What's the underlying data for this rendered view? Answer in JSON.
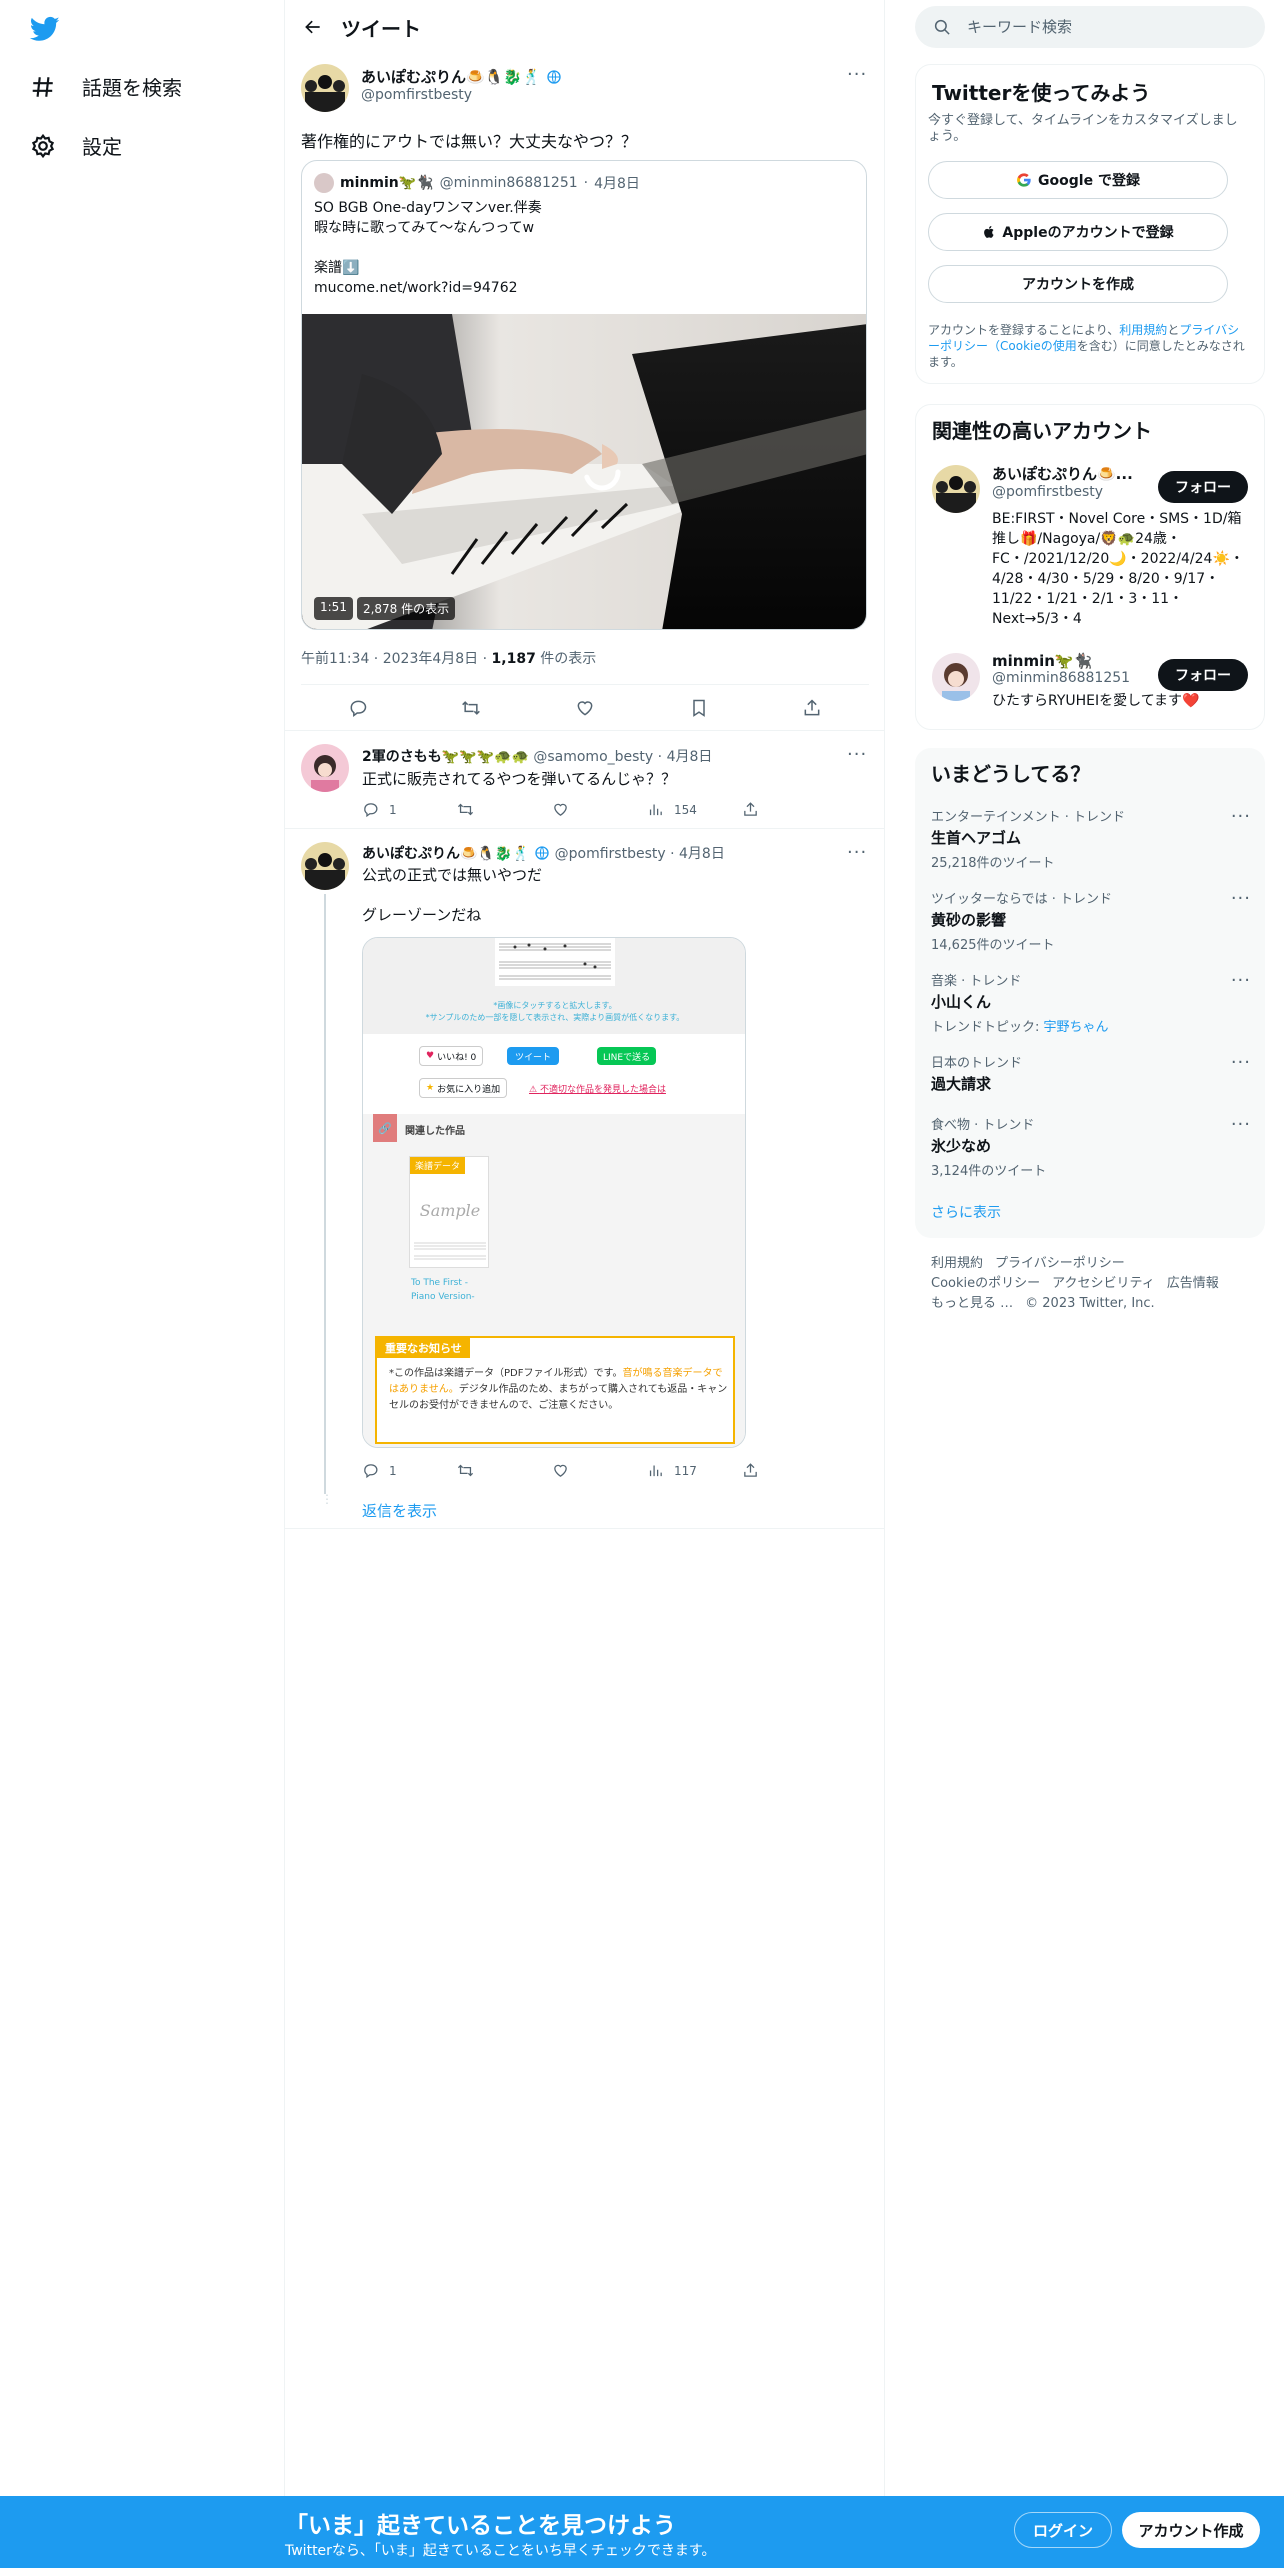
{
  "nav": {
    "explore_label": "話題を検索",
    "settings_label": "設定"
  },
  "header": {
    "title": "ツイート"
  },
  "main_tweet": {
    "display_name": "あいぽむぷりん🍮🐧🐉🕺",
    "handle": "@pomfirstbesty",
    "text": "著作権的にアウトでは無い？大丈夫なやつ？？",
    "quote": {
      "display_name": "minmin🦖🐈‍⬛",
      "handle": "@minmin86881251",
      "date": "4月8日",
      "lines": [
        "SO BGB One-dayワンマンver.伴奏",
        "暇な時に歌ってみて〜なんつってw",
        "",
        "楽譜⬇️",
        "mucome.net/work?id=94762"
      ],
      "video_duration": "1:51",
      "video_views": "2,878 件の表示"
    },
    "time": "午前11:34",
    "date": "2023年4月8日",
    "views_count": "1,187",
    "views_label": "件の表示"
  },
  "replies": [
    {
      "display_name": "2軍のさもも🦖🦖🦖🐢🐢",
      "handle": "@samomo_besty",
      "date": "4月8日",
      "text": "正式に販売されてるやつを弾いてるんじゃ？？",
      "reply_count": "1",
      "views": "154"
    },
    {
      "display_name": "あいぽむぷりん🍮🐧🐉🕺",
      "handle": "@pomfirstbesty",
      "date": "4月8日",
      "text1": "公式の正式では無いやつだ",
      "text2": "グレーゾーンだね",
      "reply_count": "1",
      "views": "117",
      "embed": {
        "caption1": "*画像にタッチすると拡大します。",
        "caption2": "*サンプルのため一部を隠して表示され、実際より画質が低くなります。",
        "like": "いいね! 0",
        "tweet": "ツイート",
        "line": "LINEで送る",
        "fav": "お気に入り追加",
        "report": "不適切な作品を発見した場合は",
        "related": "関連した作品",
        "badge": "楽譜データ",
        "sample": "Sample",
        "work_title": "To The First -Piano Version-",
        "notice_title": "重要なお知らせ",
        "notice_a": "*この作品は楽譜データ（PDFファイル形式）です。",
        "notice_b": "音が鳴る音楽データではありません。",
        "notice_c": "デジタル作品のため、まちがって購入されても返品・キャンセルのお受付ができませんので、ご注意ください。"
      }
    }
  ],
  "show_replies": "返信を表示",
  "sidebar": {
    "search_placeholder": "キーワード検索",
    "signup_card": {
      "title": "Twitterを使ってみよう",
      "subtitle": "今すぐ登録して、タイムラインをカスタマイズしましょう。",
      "google": "Google で登録",
      "apple": "Appleのアカウントで登録",
      "create": "アカウントを作成",
      "legal_a": "アカウントを登録することにより、",
      "legal_terms": "利用規約",
      "legal_and": "と",
      "legal_privacy": "プライバシーポリシー（Cookieの使用",
      "legal_b": "を含む）に同意したとみなされます。"
    },
    "related": {
      "title": "関連性の高いアカウント",
      "follow": "フォロー",
      "accounts": [
        {
          "name": "あいぽむぷりん🍮...",
          "handle": "@pomfirstbesty",
          "bio": "BE:FIRST・Novel Core・SMS・1D/箱推し🎁/Nagoya/🦁🐢24歳・FC・/2021/12/20🌙・2022/4/24☀️・4/28・4/30・5/29・8/20・9/17・11/22・1/21・2/1・3・11・Next→5/3・4"
        },
        {
          "name": "minmin🦖🐈‍⬛",
          "handle": "@minmin86881251",
          "bio": "ひたすらRYUHEIを愛してます❤️"
        }
      ]
    },
    "trends": {
      "title": "いまどうしてる？",
      "items": [
        {
          "cat": "エンターテインメント · トレンド",
          "title": "生首ヘアゴム",
          "count": "25,218件のツイート"
        },
        {
          "cat": "ツイッターならでは · トレンド",
          "title": "黄砂の影響",
          "count": "14,625件のツイート"
        },
        {
          "cat": "音楽 · トレンド",
          "title": "小山くん",
          "topic_label": "トレンドトピック:",
          "topic": "宇野ちゃん"
        },
        {
          "cat": "日本のトレンド",
          "title": "過大請求"
        },
        {
          "cat": "食べ物 · トレンド",
          "title": "氷少なめ",
          "count": "3,124件のツイート"
        }
      ],
      "show_more": "さらに表示"
    },
    "footer": {
      "terms": "利用規約",
      "privacy": "プライバシーポリシー",
      "cookie": "Cookieのポリシー",
      "access": "アクセシビリティ",
      "ads": "広告情報",
      "more": "もっと見る …",
      "copyright": "© 2023 Twitter, Inc."
    }
  },
  "bottom_bar": {
    "title": "「いま」起きていることを見つけよう",
    "subtitle": "Twitterなら、「いま」起きていることをいち早くチェックできます。",
    "login": "ログイン",
    "signup": "アカウント作成"
  },
  "colors": {
    "brand": "#1d9bf0",
    "text": "#0f1419",
    "muted": "#536471"
  }
}
